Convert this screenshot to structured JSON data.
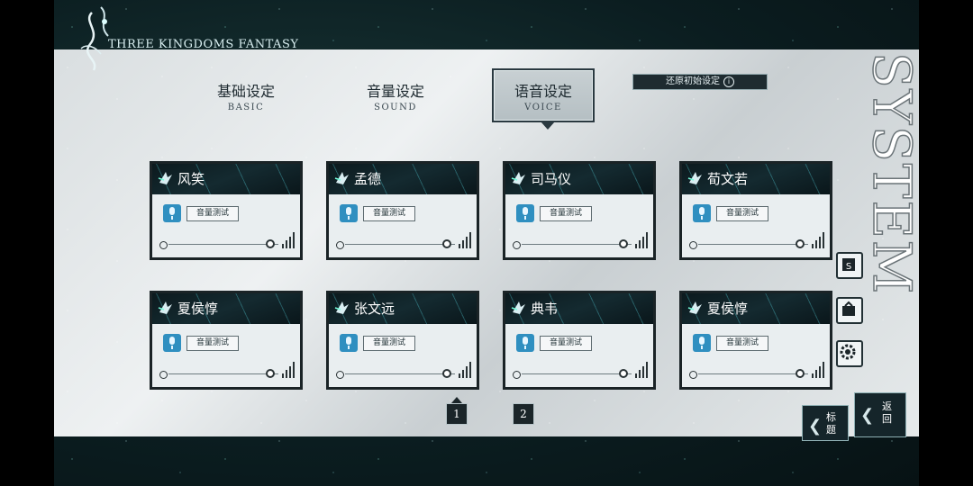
{
  "game_title": "THREE KINGDOMS FANTASY",
  "system_title": "SYSTEM",
  "tabs": [
    {
      "cn": "基础设定",
      "en": "BASIC"
    },
    {
      "cn": "音量设定",
      "en": "SOUND"
    },
    {
      "cn": "语音设定",
      "en": "VOICE"
    }
  ],
  "active_tab": "VOICE",
  "reset_label": "还原初始设定",
  "reset_icon": "info-icon",
  "test_label": "音量测试",
  "characters": [
    {
      "name": "风笑"
    },
    {
      "name": "孟德"
    },
    {
      "name": "司马仪"
    },
    {
      "name": "荀文若"
    },
    {
      "name": "夏侯惇"
    },
    {
      "name": "张文远"
    },
    {
      "name": "典韦"
    },
    {
      "name": "夏侯惇"
    }
  ],
  "pages": [
    "1",
    "2"
  ],
  "current_page": "1",
  "side_buttons": [
    "save-icon",
    "load-icon",
    "settings-icon"
  ],
  "bottom_buttons": {
    "title": "标\n题",
    "back": "返\n回"
  },
  "colors": {
    "accent": "#2f8fc0",
    "dark": "#1b2529",
    "panel": "#e6eaeb"
  }
}
